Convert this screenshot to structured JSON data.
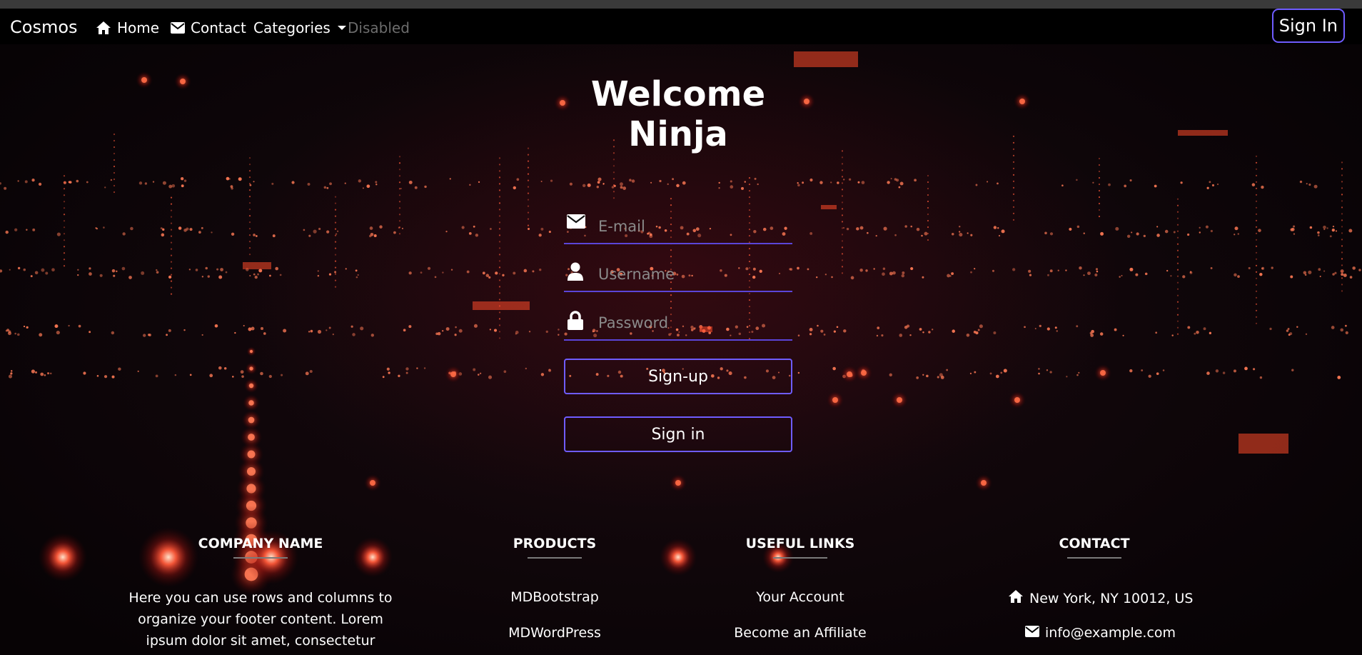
{
  "navbar": {
    "brand": "Cosmos",
    "home_label": "Home",
    "contact_label": "Contact",
    "categories_label": "Categories",
    "disabled_label": "Disabled",
    "signin_label": "Sign In"
  },
  "hero": {
    "welcome_line1": "Welcome",
    "welcome_line2": "Ninja"
  },
  "form": {
    "email_placeholder": "E-mail",
    "username_placeholder": "Username",
    "password_placeholder": "Password",
    "signup_label": "Sign-up",
    "signin_label": "Sign in"
  },
  "footer": {
    "company": {
      "title": "COMPANY NAME",
      "text": "Here you can use rows and columns to organize your footer content. Lorem ipsum dolor sit amet, consectetur adipisicing elit."
    },
    "products": {
      "title": "PRODUCTS",
      "items": [
        "MDBootstrap",
        "MDWordPress"
      ]
    },
    "useful_links": {
      "title": "USEFUL LINKS",
      "items": [
        "Your Account",
        "Become an Affiliate"
      ]
    },
    "contact": {
      "title": "CONTACT",
      "address": "New York, NY 10012, US",
      "email": "info@example.com"
    }
  },
  "colors": {
    "accent": "#6f5cff",
    "particle": "#ff4a2a",
    "navbar_bg": "#000000",
    "page_bg": "#0b0508"
  }
}
